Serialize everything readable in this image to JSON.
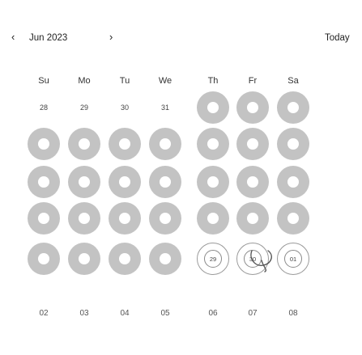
{
  "header": {
    "prev_icon": "‹",
    "month": "Jun 2023",
    "next_icon": "›",
    "today": "Today"
  },
  "weekdays": [
    "Su",
    "Mo",
    "Tu",
    "We",
    "Th",
    "Fr",
    "Sa"
  ],
  "rows": [
    [
      {
        "label": "28",
        "state": "plain"
      },
      {
        "label": "29",
        "state": "plain"
      },
      {
        "label": "30",
        "state": "plain"
      },
      {
        "label": "31",
        "state": "plain"
      },
      {
        "label": "",
        "state": "filled"
      },
      {
        "label": "",
        "state": "filled"
      },
      {
        "label": "",
        "state": "filled"
      }
    ],
    [
      {
        "label": "",
        "state": "filled"
      },
      {
        "label": "",
        "state": "filled"
      },
      {
        "label": "",
        "state": "filled"
      },
      {
        "label": "",
        "state": "filled"
      },
      {
        "label": "",
        "state": "filled"
      },
      {
        "label": "",
        "state": "filled"
      },
      {
        "label": "",
        "state": "filled"
      }
    ],
    [
      {
        "label": "",
        "state": "filled"
      },
      {
        "label": "",
        "state": "filled"
      },
      {
        "label": "",
        "state": "filled"
      },
      {
        "label": "",
        "state": "filled"
      },
      {
        "label": "",
        "state": "filled"
      },
      {
        "label": "",
        "state": "filled"
      },
      {
        "label": "",
        "state": "filled"
      }
    ],
    [
      {
        "label": "",
        "state": "filled"
      },
      {
        "label": "",
        "state": "filled"
      },
      {
        "label": "",
        "state": "filled"
      },
      {
        "label": "",
        "state": "filled"
      },
      {
        "label": "",
        "state": "filled"
      },
      {
        "label": "",
        "state": "filled"
      },
      {
        "label": "",
        "state": "filled"
      }
    ],
    [
      {
        "label": "",
        "state": "filled"
      },
      {
        "label": "",
        "state": "filled"
      },
      {
        "label": "",
        "state": "filled"
      },
      {
        "label": "",
        "state": "filled"
      },
      {
        "label": "29",
        "state": "outlined"
      },
      {
        "label": "30",
        "state": "outlined"
      },
      {
        "label": "01",
        "state": "outlined"
      }
    ]
  ],
  "footer": [
    "02",
    "03",
    "04",
    "05",
    "06",
    "07",
    "08"
  ],
  "colors": {
    "filled": "#c3c3c3",
    "dot": "#ffffff",
    "outline": "#9a9a9a"
  }
}
